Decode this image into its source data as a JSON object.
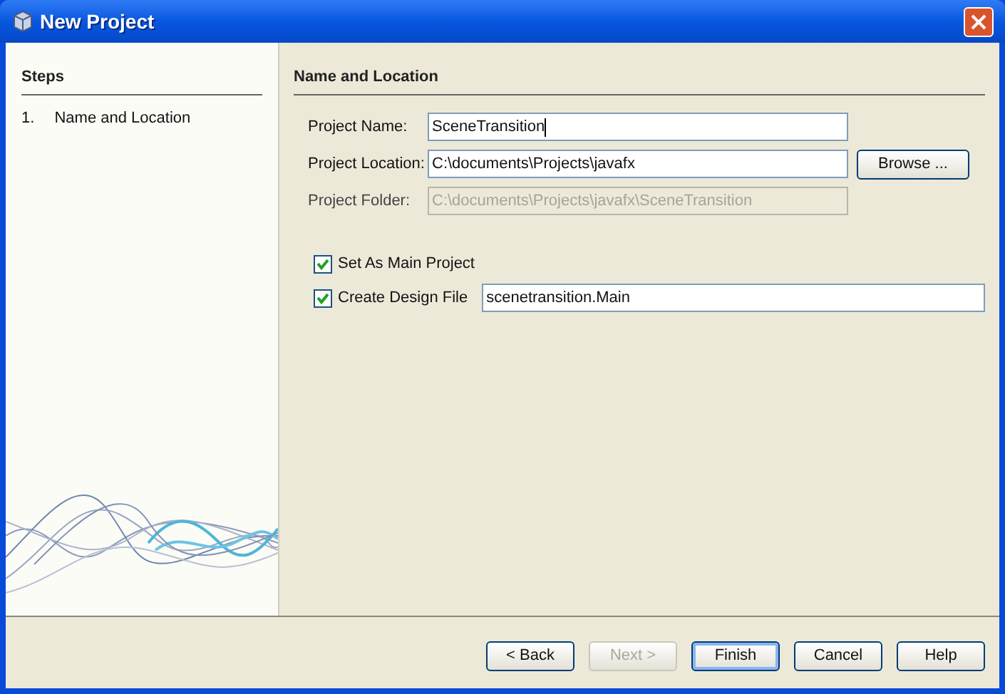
{
  "window": {
    "title": "New Project"
  },
  "steps": {
    "title": "Steps",
    "items": [
      {
        "number": "1.",
        "label": "Name and Location",
        "selected": true
      }
    ]
  },
  "panel": {
    "title": "Name and Location"
  },
  "fields": [
    {
      "label": "Project Name:",
      "value": "SceneTransition",
      "disabled": false,
      "focused": true
    },
    {
      "label": "Project Location:",
      "value": "C:\\documents\\Projects\\javafx",
      "disabled": false,
      "focused": false,
      "button": "Browse ..."
    },
    {
      "label": "Project Folder:",
      "value": "C:\\documents\\Projects\\javafx\\SceneTransition",
      "disabled": true,
      "focused": false
    }
  ],
  "options": [
    {
      "label": "Set As Main Project",
      "checked": true
    },
    {
      "label": "Create Design File",
      "checked": true,
      "value": "scenetransition.Main"
    }
  ],
  "buttons": [
    {
      "label": "< Back",
      "disabled": false,
      "default": false
    },
    {
      "label": "Next >",
      "disabled": true,
      "default": false
    },
    {
      "label": "Finish",
      "disabled": false,
      "default": true
    },
    {
      "label": "Cancel",
      "disabled": false,
      "default": false
    },
    {
      "label": "Help",
      "disabled": false,
      "default": false
    }
  ]
}
